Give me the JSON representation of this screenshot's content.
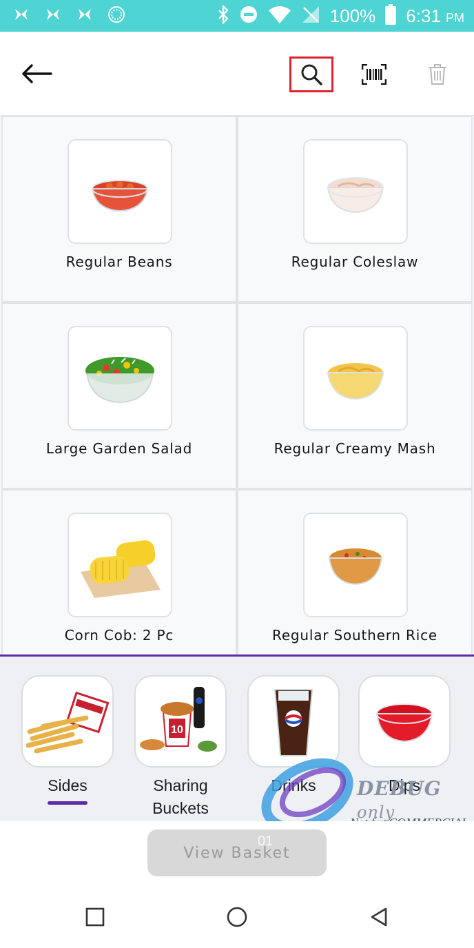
{
  "status_bar": {
    "battery": "100%",
    "time": "6:31",
    "ampm": "PM",
    "icons": [
      "butterfly-icon",
      "butterfly-icon",
      "butterfly-icon",
      "app-circle-icon",
      "bluetooth-icon",
      "do-not-disturb-icon",
      "wifi-icon",
      "no-signal-icon",
      "battery-icon"
    ]
  },
  "toolbar": {
    "icons": [
      "back-arrow-icon",
      "search-icon",
      "barcode-scanner-icon",
      "trash-icon"
    ],
    "colors": {
      "search_highlight": "#e0202e"
    }
  },
  "products": [
    {
      "name": "Regular Beans",
      "icon": "beans-bowl-image"
    },
    {
      "name": "Regular Coleslaw",
      "icon": "coleslaw-bowl-image"
    },
    {
      "name": "Large Garden Salad",
      "icon": "salad-bowl-image"
    },
    {
      "name": "Regular Creamy Mash",
      "icon": "mash-bowl-image"
    },
    {
      "name": "Corn Cob: 2 Pc",
      "icon": "corn-cob-image"
    },
    {
      "name": "Regular Southern Rice",
      "icon": "rice-bowl-image"
    }
  ],
  "categories": {
    "items": [
      {
        "label": "Sides",
        "icon": "fries-image",
        "selected": true
      },
      {
        "label": "Sharing Buckets",
        "icon": "bucket-image",
        "selected": false
      },
      {
        "label": "Drinks",
        "icon": "drink-glass-image",
        "selected": false
      },
      {
        "label": "Dips",
        "icon": "dip-bowl-image",
        "selected": false
      }
    ],
    "colors": {
      "accent": "#5b2ca5",
      "background": "#eef0f3"
    }
  },
  "watermark": {
    "debug": "DEBUG",
    "only": "only",
    "not_for": "Not for COMMERCIAL"
  },
  "basket": {
    "label": "View Basket",
    "count": "01"
  },
  "nav": {
    "icons": [
      "recents-square-icon",
      "home-circle-icon",
      "back-triangle-icon"
    ]
  },
  "colors": {
    "status_bar": "#4fd4d4",
    "grid_background": "#f7f9fb",
    "button_disabled": "#d8d8d8"
  }
}
